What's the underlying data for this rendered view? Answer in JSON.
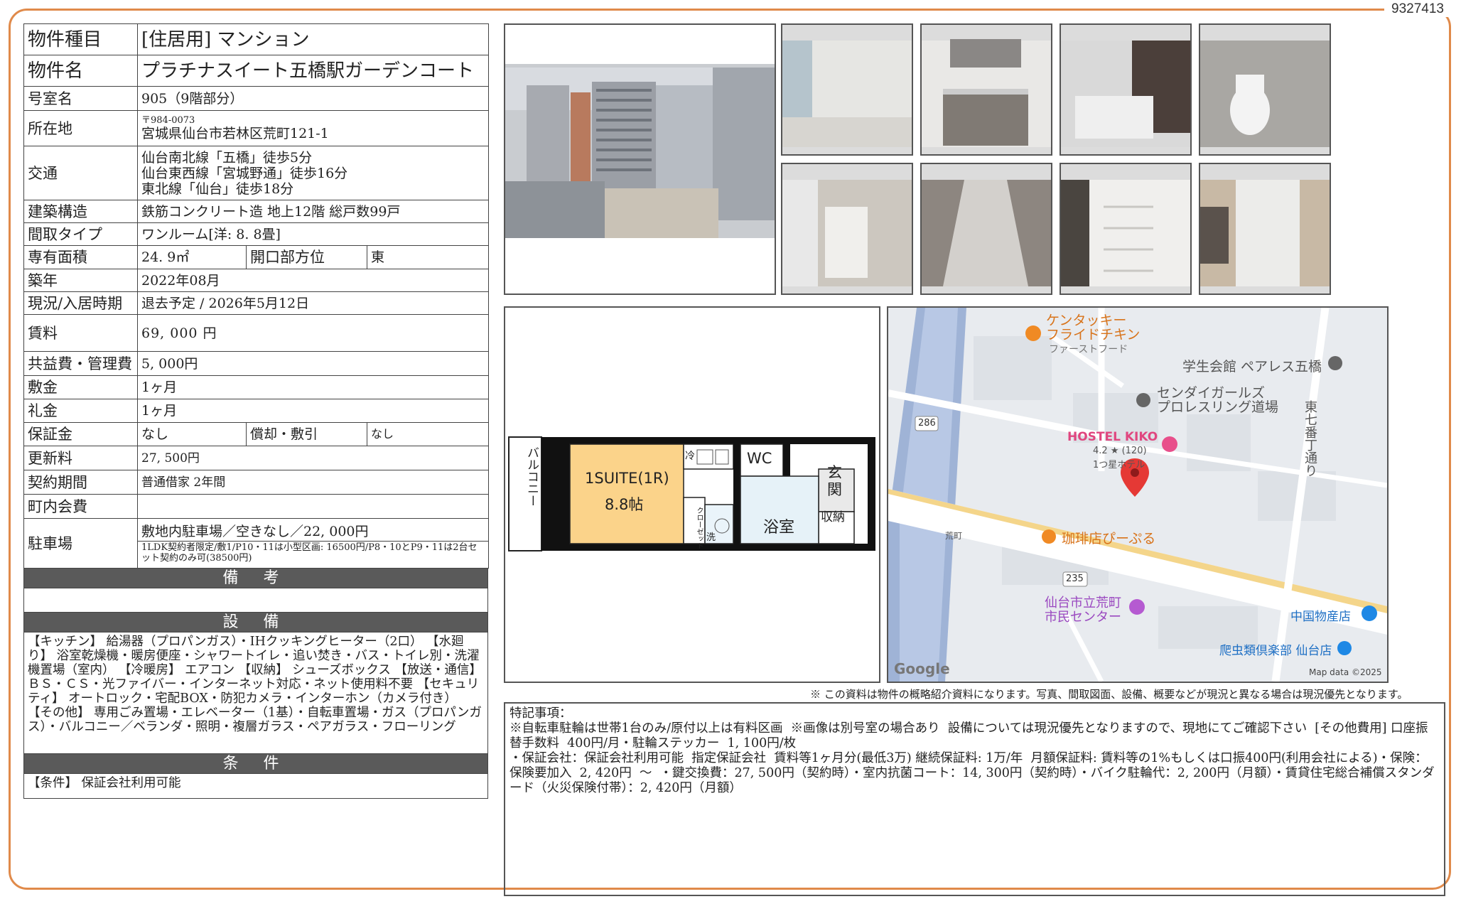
{
  "doc_id": "9327413",
  "property": {
    "type_label": "物件種目",
    "type_value": "[住居用]  マンション",
    "name_label": "物件名",
    "name_value": "プラチナスイート五橋駅ガーデンコート",
    "room_label": "号室名",
    "room_value": "905（9階部分）",
    "address_label": "所在地",
    "postal": "〒984-0073",
    "address": "宮城県仙台市若林区荒町121-1",
    "transport_label": "交通",
    "transport": [
      "仙台南北線「五橋」徒歩5分",
      "仙台東西線「宮城野通」徒歩16分",
      "東北線「仙台」徒歩18分"
    ],
    "structure_label": "建築構造",
    "structure_value": "鉄筋コンクリート造  地上12階  総戸数99戸",
    "layout_label": "間取タイプ",
    "layout_value": "ワンルーム[洋: 8. 8畳]",
    "area_label": "専有面積",
    "area_value": "24. 9㎡",
    "facing_label": "開口部方位",
    "facing_value": "東",
    "built_label": "築年",
    "built_value": "2022年08月",
    "status_label": "現況/入居時期",
    "status_value": "退去予定  /   2026年5月12日",
    "rent_label": "賃料",
    "rent_value": "69, 000  円",
    "fee_label": "共益費・管理費",
    "fee_value": "5, 000円",
    "deposit_label": "敷金",
    "deposit_value": "1ヶ月",
    "key_money_label": "礼金",
    "key_money_value": "1ヶ月",
    "guarantee_label": "保証金",
    "guarantee_value": "なし",
    "amort_label": "償却・敷引",
    "amort_value": "なし",
    "renewal_label": "更新料",
    "renewal_value": "27, 500円",
    "contract_label": "契約期間",
    "contract_value": "普通借家  2年間",
    "community_label": "町内会費",
    "community_value": "",
    "parking_label": "駐車場",
    "parking_value": "敷地内駐車場／空きなし／22, 000円",
    "parking_note": "1LDK契約者限定/敷1/P10・11は小型区画: 16500円/P8・10とP9・11は2台セット契約のみ可(38500円)"
  },
  "sections": {
    "remarks_title": "備 考",
    "equipment_title": "設 備",
    "equipment_text": "【キッチン】 給湯器（プロパンガス）・IHクッキングヒーター（2口）  【水廻り】 浴室乾燥機・暖房便座・シャワートイレ・追い焚き・バス・トイレ別・洗濯機置場（室内）  【冷暖房】 エアコン  【収納】 シューズボックス  【放送・通信】 ＢＳ・ＣＳ・光ファイバー・インターネット対応・ネット使用料不要  【セキュリティ】 オートロック・宅配BOX・防犯カメラ・インターホン（カメラ付き）  【その他】 専用ごみ置場・エレベーター（1基）・自転車置場・ガス（プロパンガス）・バルコニー／ベランダ・照明・複層ガラス・ペアガラス・フローリング",
    "conditions_title": "条 件",
    "conditions_text": "【条件】  保証会社利用可能"
  },
  "floorplan": {
    "balcony": "バルコニー",
    "room_name": "1SUITE(1R)",
    "room_size": "8.8帖",
    "wc": "WC",
    "entrance": "玄関",
    "storage": "収納",
    "bath": "浴室",
    "closet": "クローゼット",
    "fridge": "冷",
    "washer": "洗"
  },
  "map": {
    "poi_kfc": "ケンタッキー\nフライドチキン",
    "poi_kfc_sub": "ファーストフード",
    "poi_hall": "学生会館 ペアレス五橋",
    "poi_gym": "センダイガールズ\nプロレスリング道場",
    "poi_hotel": "HOSTEL KIKO",
    "poi_hotel_rating": "4.2 ★ (120)",
    "poi_hotel_sub": "1つ星ホテル",
    "poi_cafe": "珈琲店ぴーぷる",
    "poi_center": "仙台市立荒町\n市民センター",
    "poi_store": "中国物産店",
    "poi_reptile": "爬虫類倶楽部 仙台店",
    "street": "東七番丁通り",
    "route_286": "286",
    "route_235": "235",
    "signal": "荒町",
    "google": "Google",
    "mapdata": "Map data ©2025"
  },
  "notice": "※ この資料は物件の概略紹介資料になります。写真、間取図面、設備、概要などが現況と異なる場合は現況優先となります。",
  "remarks": {
    "heading": "特記事項：",
    "text": "※自転車駐輪は世帯1台のみ/原付以上は有料区画  ※画像は別号室の場合あり  設備については現況優先となりますので、現地にてご確認下さい  [その他費用] 口座振替手数料  400円/月・駐輪ステッカー  1, 100円/枚\n・保証会社：保証会社利用可能  指定保証会社  賃料等1ヶ月分(最低3万) 継続保証料: 1万/年  月額保証料: 賃料等の1%もしくは口振400円(利用会社による)・保険：保険要加入  2, 420円  〜  ・鍵交換費：27, 500円（契約時）・室内抗菌コート：14, 300円（契約時）・バイク駐輪代：2, 200円（月額）・賃貸住宅総合補償スタンダード（火災保険付帯）：2, 420円（月額）"
  }
}
